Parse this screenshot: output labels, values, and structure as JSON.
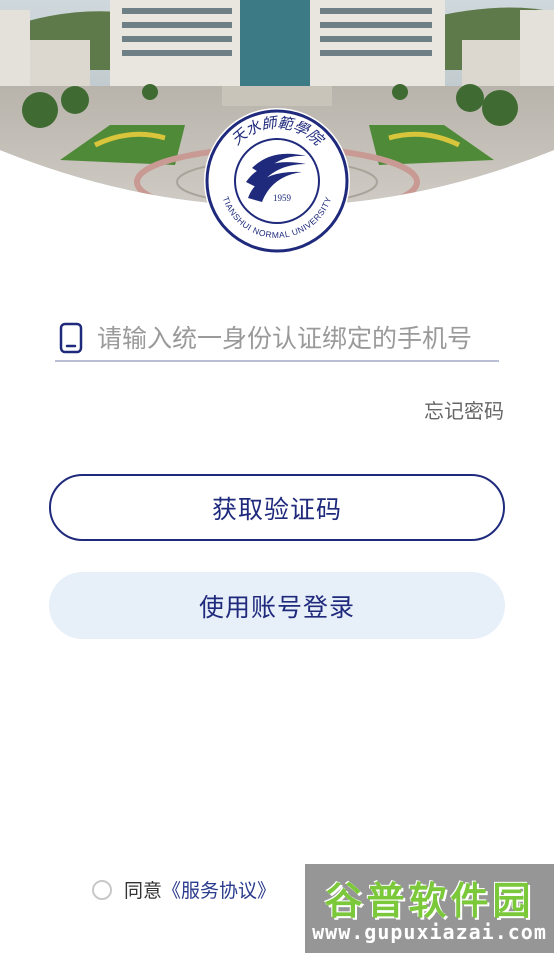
{
  "header": {
    "campus_photo": "campus-building-photo",
    "logo": {
      "name_cn": "天水師範學院",
      "name_en": "TIANSHUI NORMAL UNIVERSITY",
      "year": "1959",
      "color": "#1f2a7c"
    }
  },
  "login": {
    "phone_placeholder": "请输入统一身份认证绑定的手机号",
    "phone_value": "",
    "phone_icon": "mobile-phone-icon",
    "forgot_password": "忘记密码",
    "get_code_button": "获取验证码",
    "account_login_button": "使用账号登录"
  },
  "agreement": {
    "prefix": "同意",
    "service_agreement": "《服务协议》"
  },
  "watermark": {
    "title": "谷普软件园",
    "url": "www.gupuxiazai.com"
  },
  "colors": {
    "accent": "#1f2a7c",
    "account_button_bg": "#e7eff9",
    "watermark_green": "#7bc83a"
  }
}
